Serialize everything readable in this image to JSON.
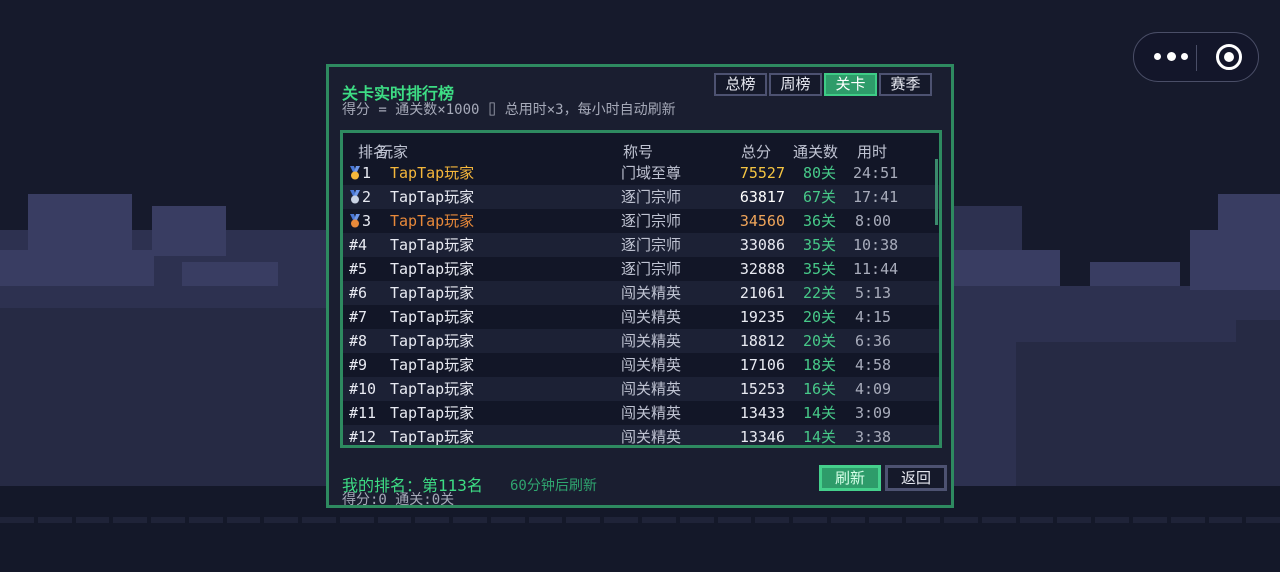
{
  "capsule": {
    "more_icon": "more-dots-icon",
    "close_icon": "target-close-icon"
  },
  "panel": {
    "title": "关卡实时排行榜",
    "subtitle": "得分 = 通关数×1000 ⌷  总用时×3，每小时自动刷新",
    "tabs": [
      {
        "label": "总榜",
        "active": false
      },
      {
        "label": "周榜",
        "active": false
      },
      {
        "label": "关卡",
        "active": true
      },
      {
        "label": "赛季",
        "active": false
      }
    ],
    "columns": {
      "rank": "排名",
      "player": "玩家",
      "title": "称号",
      "total": "总分",
      "clears": "通关数",
      "time": "用时"
    },
    "rows": [
      {
        "rank": "1",
        "medal": "gold",
        "player": "TapTap玩家",
        "title": "门域至尊",
        "total": "75527",
        "clears": "80关",
        "time": "24:51"
      },
      {
        "rank": "2",
        "medal": "silver",
        "player": "TapTap玩家",
        "title": "逐门宗师",
        "total": "63817",
        "clears": "67关",
        "time": "17:41"
      },
      {
        "rank": "3",
        "medal": "bronze",
        "player": "TapTap玩家",
        "title": "逐门宗师",
        "total": "34560",
        "clears": "36关",
        "time": "8:00"
      },
      {
        "rank": "#4",
        "player": "TapTap玩家",
        "title": "逐门宗师",
        "total": "33086",
        "clears": "35关",
        "time": "10:38"
      },
      {
        "rank": "#5",
        "player": "TapTap玩家",
        "title": "逐门宗师",
        "total": "32888",
        "clears": "35关",
        "time": "11:44"
      },
      {
        "rank": "#6",
        "player": "TapTap玩家",
        "title": "闯关精英",
        "total": "21061",
        "clears": "22关",
        "time": "5:13"
      },
      {
        "rank": "#7",
        "player": "TapTap玩家",
        "title": "闯关精英",
        "total": "19235",
        "clears": "20关",
        "time": "4:15"
      },
      {
        "rank": "#8",
        "player": "TapTap玩家",
        "title": "闯关精英",
        "total": "18812",
        "clears": "20关",
        "time": "6:36"
      },
      {
        "rank": "#9",
        "player": "TapTap玩家",
        "title": "闯关精英",
        "total": "17106",
        "clears": "18关",
        "time": "4:58"
      },
      {
        "rank": "#10",
        "player": "TapTap玩家",
        "title": "闯关精英",
        "total": "15253",
        "clears": "16关",
        "time": "4:09"
      },
      {
        "rank": "#11",
        "player": "TapTap玩家",
        "title": "闯关精英",
        "total": "13433",
        "clears": "14关",
        "time": "3:09"
      },
      {
        "rank": "#12",
        "player": "TapTap玩家",
        "title": "闯关精英",
        "total": "13346",
        "clears": "14关",
        "time": "3:38"
      }
    ],
    "my_rank": "我的排名：第113名",
    "refresh_note": "60分钟后刷新",
    "my_stats": "得分:0  通关:0关",
    "refresh_button": "刷新",
    "back_button": "返回"
  },
  "colors": {
    "accent": "#2e9c6a",
    "accent_text": "#3ddc84",
    "gold": "#f5b73b",
    "bronze": "#e8893a",
    "medal_ribbon": "#4a78d6"
  }
}
